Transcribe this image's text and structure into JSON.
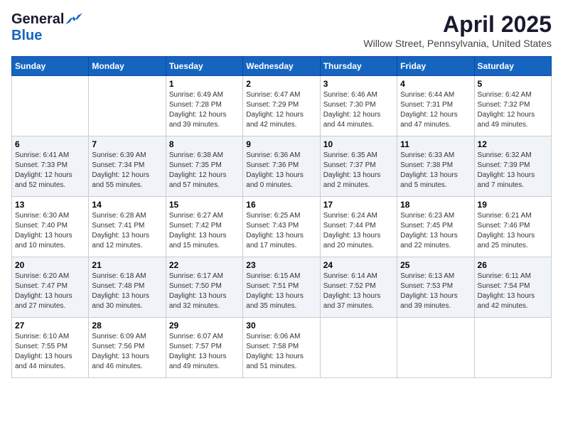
{
  "header": {
    "logo_general": "General",
    "logo_blue": "Blue",
    "month_title": "April 2025",
    "location": "Willow Street, Pennsylvania, United States"
  },
  "days_of_week": [
    "Sunday",
    "Monday",
    "Tuesday",
    "Wednesday",
    "Thursday",
    "Friday",
    "Saturday"
  ],
  "weeks": [
    [
      {
        "day": "",
        "info": ""
      },
      {
        "day": "",
        "info": ""
      },
      {
        "day": "1",
        "info": "Sunrise: 6:49 AM\nSunset: 7:28 PM\nDaylight: 12 hours and 39 minutes."
      },
      {
        "day": "2",
        "info": "Sunrise: 6:47 AM\nSunset: 7:29 PM\nDaylight: 12 hours and 42 minutes."
      },
      {
        "day": "3",
        "info": "Sunrise: 6:46 AM\nSunset: 7:30 PM\nDaylight: 12 hours and 44 minutes."
      },
      {
        "day": "4",
        "info": "Sunrise: 6:44 AM\nSunset: 7:31 PM\nDaylight: 12 hours and 47 minutes."
      },
      {
        "day": "5",
        "info": "Sunrise: 6:42 AM\nSunset: 7:32 PM\nDaylight: 12 hours and 49 minutes."
      }
    ],
    [
      {
        "day": "6",
        "info": "Sunrise: 6:41 AM\nSunset: 7:33 PM\nDaylight: 12 hours and 52 minutes."
      },
      {
        "day": "7",
        "info": "Sunrise: 6:39 AM\nSunset: 7:34 PM\nDaylight: 12 hours and 55 minutes."
      },
      {
        "day": "8",
        "info": "Sunrise: 6:38 AM\nSunset: 7:35 PM\nDaylight: 12 hours and 57 minutes."
      },
      {
        "day": "9",
        "info": "Sunrise: 6:36 AM\nSunset: 7:36 PM\nDaylight: 13 hours and 0 minutes."
      },
      {
        "day": "10",
        "info": "Sunrise: 6:35 AM\nSunset: 7:37 PM\nDaylight: 13 hours and 2 minutes."
      },
      {
        "day": "11",
        "info": "Sunrise: 6:33 AM\nSunset: 7:38 PM\nDaylight: 13 hours and 5 minutes."
      },
      {
        "day": "12",
        "info": "Sunrise: 6:32 AM\nSunset: 7:39 PM\nDaylight: 13 hours and 7 minutes."
      }
    ],
    [
      {
        "day": "13",
        "info": "Sunrise: 6:30 AM\nSunset: 7:40 PM\nDaylight: 13 hours and 10 minutes."
      },
      {
        "day": "14",
        "info": "Sunrise: 6:28 AM\nSunset: 7:41 PM\nDaylight: 13 hours and 12 minutes."
      },
      {
        "day": "15",
        "info": "Sunrise: 6:27 AM\nSunset: 7:42 PM\nDaylight: 13 hours and 15 minutes."
      },
      {
        "day": "16",
        "info": "Sunrise: 6:25 AM\nSunset: 7:43 PM\nDaylight: 13 hours and 17 minutes."
      },
      {
        "day": "17",
        "info": "Sunrise: 6:24 AM\nSunset: 7:44 PM\nDaylight: 13 hours and 20 minutes."
      },
      {
        "day": "18",
        "info": "Sunrise: 6:23 AM\nSunset: 7:45 PM\nDaylight: 13 hours and 22 minutes."
      },
      {
        "day": "19",
        "info": "Sunrise: 6:21 AM\nSunset: 7:46 PM\nDaylight: 13 hours and 25 minutes."
      }
    ],
    [
      {
        "day": "20",
        "info": "Sunrise: 6:20 AM\nSunset: 7:47 PM\nDaylight: 13 hours and 27 minutes."
      },
      {
        "day": "21",
        "info": "Sunrise: 6:18 AM\nSunset: 7:48 PM\nDaylight: 13 hours and 30 minutes."
      },
      {
        "day": "22",
        "info": "Sunrise: 6:17 AM\nSunset: 7:50 PM\nDaylight: 13 hours and 32 minutes."
      },
      {
        "day": "23",
        "info": "Sunrise: 6:15 AM\nSunset: 7:51 PM\nDaylight: 13 hours and 35 minutes."
      },
      {
        "day": "24",
        "info": "Sunrise: 6:14 AM\nSunset: 7:52 PM\nDaylight: 13 hours and 37 minutes."
      },
      {
        "day": "25",
        "info": "Sunrise: 6:13 AM\nSunset: 7:53 PM\nDaylight: 13 hours and 39 minutes."
      },
      {
        "day": "26",
        "info": "Sunrise: 6:11 AM\nSunset: 7:54 PM\nDaylight: 13 hours and 42 minutes."
      }
    ],
    [
      {
        "day": "27",
        "info": "Sunrise: 6:10 AM\nSunset: 7:55 PM\nDaylight: 13 hours and 44 minutes."
      },
      {
        "day": "28",
        "info": "Sunrise: 6:09 AM\nSunset: 7:56 PM\nDaylight: 13 hours and 46 minutes."
      },
      {
        "day": "29",
        "info": "Sunrise: 6:07 AM\nSunset: 7:57 PM\nDaylight: 13 hours and 49 minutes."
      },
      {
        "day": "30",
        "info": "Sunrise: 6:06 AM\nSunset: 7:58 PM\nDaylight: 13 hours and 51 minutes."
      },
      {
        "day": "",
        "info": ""
      },
      {
        "day": "",
        "info": ""
      },
      {
        "day": "",
        "info": ""
      }
    ]
  ]
}
